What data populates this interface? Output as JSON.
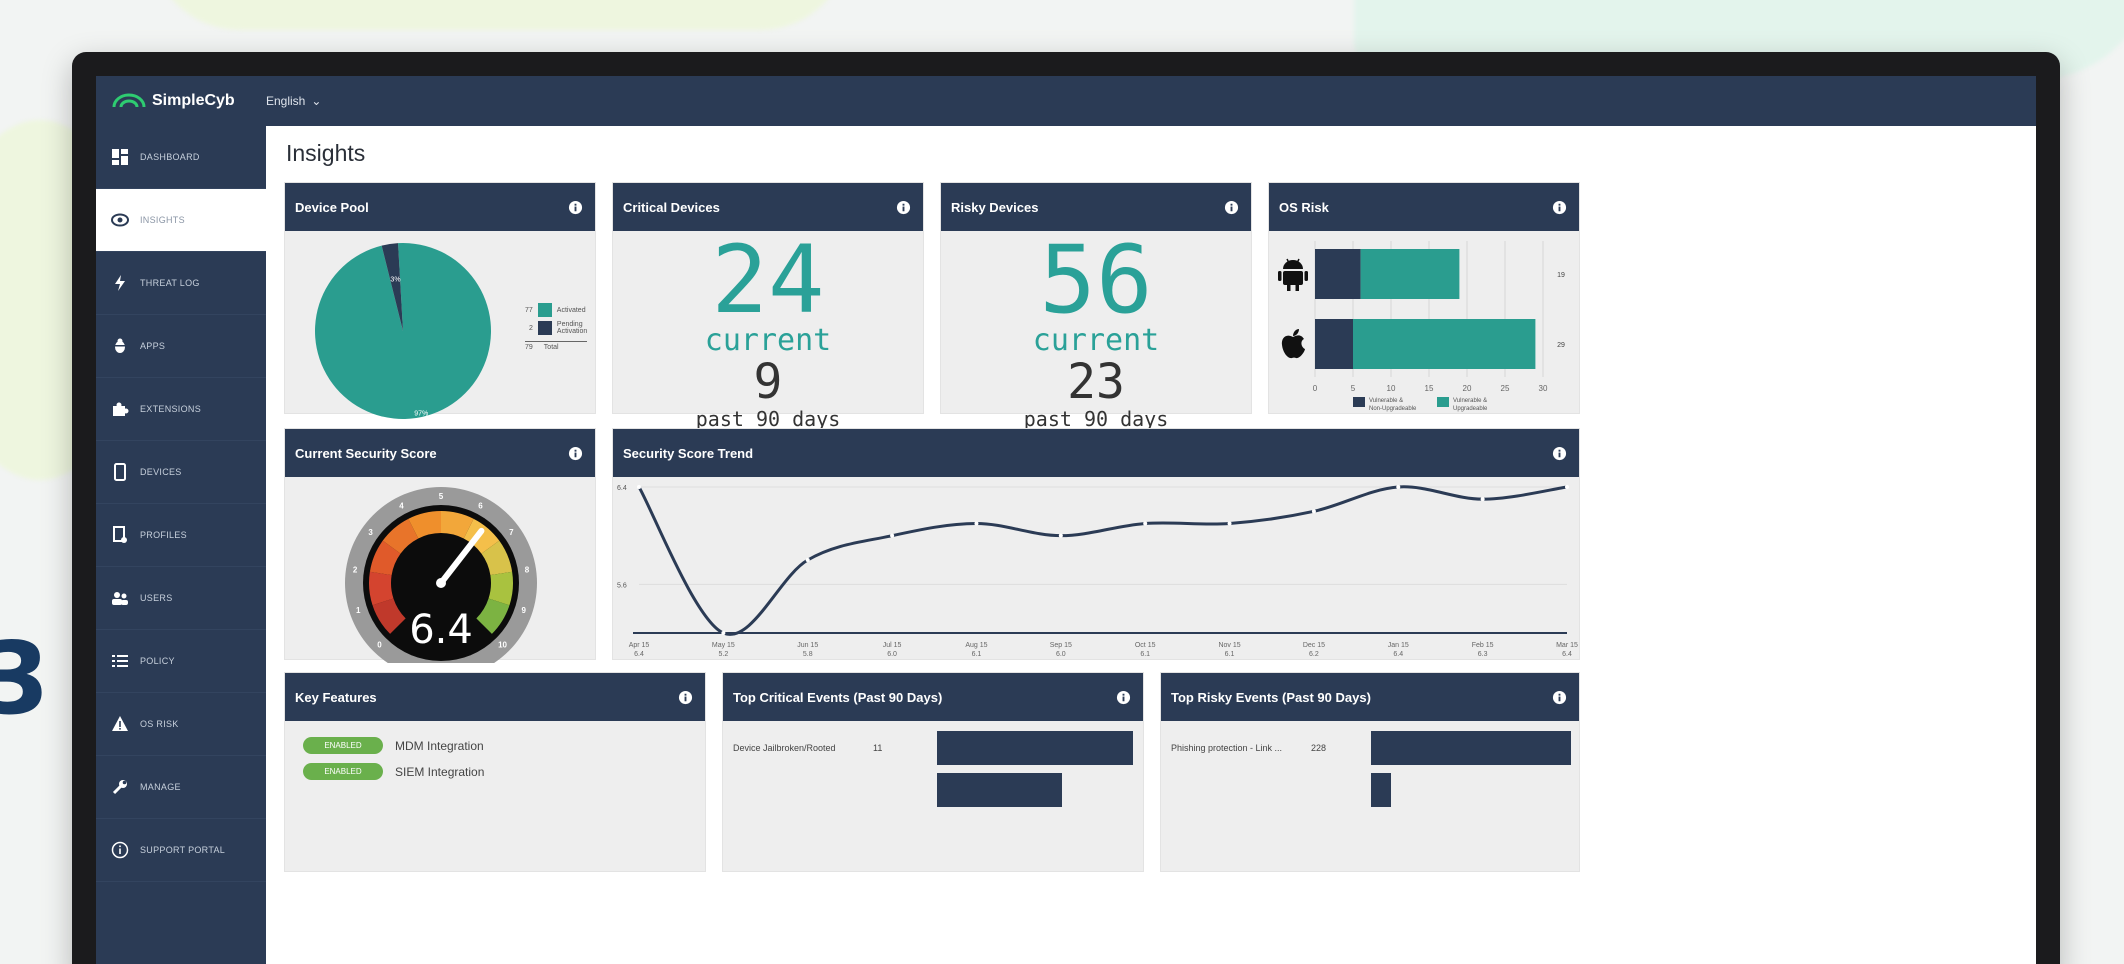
{
  "app": {
    "brand": "SimpleCyb",
    "language": "English"
  },
  "background": {
    "edge_glyph": "3"
  },
  "sidebar": {
    "items": [
      {
        "label": "DASHBOARD",
        "icon": "dashboard-icon"
      },
      {
        "label": "INSIGHTS",
        "icon": "eye-icon",
        "active": true
      },
      {
        "label": "THREAT LOG",
        "icon": "bolt-icon"
      },
      {
        "label": "APPS",
        "icon": "bug-icon"
      },
      {
        "label": "EXTENSIONS",
        "icon": "puzzle-icon"
      },
      {
        "label": "DEVICES",
        "icon": "phone-icon"
      },
      {
        "label": "PROFILES",
        "icon": "profile-icon"
      },
      {
        "label": "USERS",
        "icon": "users-icon"
      },
      {
        "label": "POLICY",
        "icon": "list-icon"
      },
      {
        "label": "OS RISK",
        "icon": "warning-icon"
      },
      {
        "label": "MANAGE",
        "icon": "wrench-icon"
      },
      {
        "label": "SUPPORT PORTAL",
        "icon": "info-circle-icon"
      }
    ]
  },
  "page": {
    "title": "Insights"
  },
  "device_pool": {
    "title": "Device Pool",
    "slices": [
      {
        "label": "97%",
        "value": 97,
        "color": "#2a9d8f"
      },
      {
        "label": "3%",
        "value": 3,
        "color": "#2b3b55"
      }
    ],
    "legend": [
      {
        "count": "77",
        "label": "Activated",
        "color": "#2a9d8f"
      },
      {
        "count": "2",
        "label": "Pending Activation",
        "color": "#2b3b55"
      }
    ],
    "total_count": "79",
    "total_label": "Total"
  },
  "critical_devices": {
    "title": "Critical Devices",
    "current": "24",
    "current_label": "current",
    "past": "9",
    "past_label": "past 90 days"
  },
  "risky_devices": {
    "title": "Risky Devices",
    "current": "56",
    "current_label": "current",
    "past": "23",
    "past_label": "past 90 days"
  },
  "os_risk": {
    "title": "OS Risk",
    "ticks": [
      "0",
      "5",
      "10",
      "15",
      "20",
      "25",
      "30"
    ],
    "rows": [
      {
        "icon": "android-icon",
        "non_upgradable": 6,
        "upgradable": 13,
        "total": "19"
      },
      {
        "icon": "apple-icon",
        "non_upgradable": 5,
        "upgradable": 24,
        "total": "29"
      }
    ],
    "legend": [
      {
        "label": "Vulnerable & Non-Upgradeable",
        "color": "#2b3b55"
      },
      {
        "label": "Vulnerable & Upgradeable",
        "color": "#2a9d8f"
      }
    ]
  },
  "security_score": {
    "title": "Current Security Score",
    "value": "6.4",
    "score": 6.4,
    "ticks": [
      "0",
      "1",
      "2",
      "3",
      "4",
      "5",
      "6",
      "7",
      "8",
      "9",
      "10"
    ]
  },
  "chart_data": {
    "type": "line",
    "title": "Security Score Trend",
    "x": [
      "Apr 15",
      "May 15",
      "Jun 15",
      "Jul 15",
      "Aug 15",
      "Sep 15",
      "Oct 15",
      "Nov 15",
      "Dec 15",
      "Jan 15",
      "Feb 15",
      "Mar 15"
    ],
    "x_values": [
      "6.4",
      "5.2",
      "5.8",
      "6.0",
      "6.1",
      "6.0",
      "6.1",
      "6.1",
      "6.2",
      "6.4",
      "6.3",
      "6.4"
    ],
    "series": [
      {
        "values": [
          6.4,
          5.2,
          5.8,
          6.0,
          6.1,
          6.0,
          6.1,
          6.1,
          6.2,
          6.4,
          6.3,
          6.4
        ],
        "color": "#2b3b55"
      }
    ],
    "y_ticks": [
      "6.4",
      "5.6"
    ],
    "ylim": [
      5.2,
      6.4
    ],
    "grid": true
  },
  "key_features": {
    "title": "Key Features",
    "items": [
      {
        "badge": "ENABLED",
        "label": "MDM Integration"
      },
      {
        "badge": "ENABLED",
        "label": "SIEM Integration"
      }
    ]
  },
  "top_critical": {
    "title": "Top Critical Events (Past 90 Days)",
    "items": [
      {
        "label": "Device Jailbroken/Rooted",
        "count": "11",
        "fraction": 1.0
      },
      {
        "label": "",
        "count": "",
        "fraction": 0.64
      }
    ]
  },
  "top_risky": {
    "title": "Top Risky Events (Past 90 Days)",
    "items": [
      {
        "label": "Phishing protection - Link ...",
        "count": "228",
        "fraction": 1.0
      },
      {
        "label": "",
        "count": "",
        "fraction": 0.1
      }
    ]
  }
}
